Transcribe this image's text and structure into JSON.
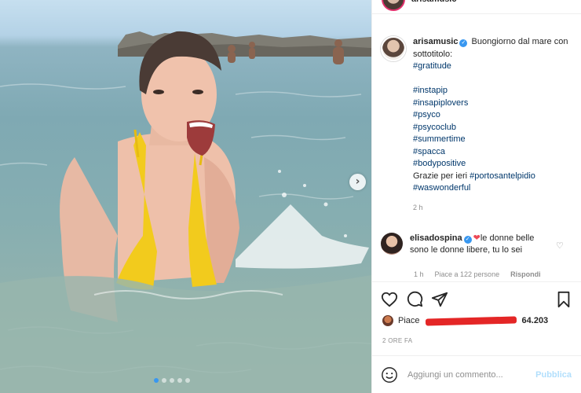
{
  "post": {
    "author": "arisamusic",
    "caption_text": "Buongiorno dal mare con sottotitolo:",
    "hashtags": [
      "#gratitude",
      "#instapip",
      "#insapiplovers",
      "#psyco",
      "#psycoclub",
      "#summertime",
      "#spacca",
      "#bodypositive"
    ],
    "thanks_text": "Grazie per ieri",
    "thanks_tag": "#portosantelpidio",
    "last_tag": "#waswonderful",
    "caption_time": "2 h",
    "top_username": "arisamusic"
  },
  "comment": {
    "user": "elisadospina",
    "text": "le donne belle sono le donne libere, tu lo sei",
    "time": "1 h",
    "likes": "Piace a 122 persone",
    "reply": "Rispondi"
  },
  "engagement": {
    "likes_prefix": "Piace",
    "likes_count": "64.203",
    "posted_ago": "2 ORE FA"
  },
  "add_comment": {
    "placeholder": "Aggiungi un commento...",
    "publish": "Pubblica"
  },
  "icons": {
    "next": "chevron-right-icon",
    "like": "heart-outline-icon",
    "comment": "speech-bubble-icon",
    "share": "paper-plane-icon",
    "save": "bookmark-icon",
    "emoji": "smiley-icon"
  },
  "carousel": {
    "slides": 5,
    "active_index": 0
  },
  "colors": {
    "link": "#00376b",
    "accent": "#3897f0",
    "heart": "#ed4956",
    "muted": "#8e8e8e",
    "publish_disabled": "#b2dffc"
  }
}
